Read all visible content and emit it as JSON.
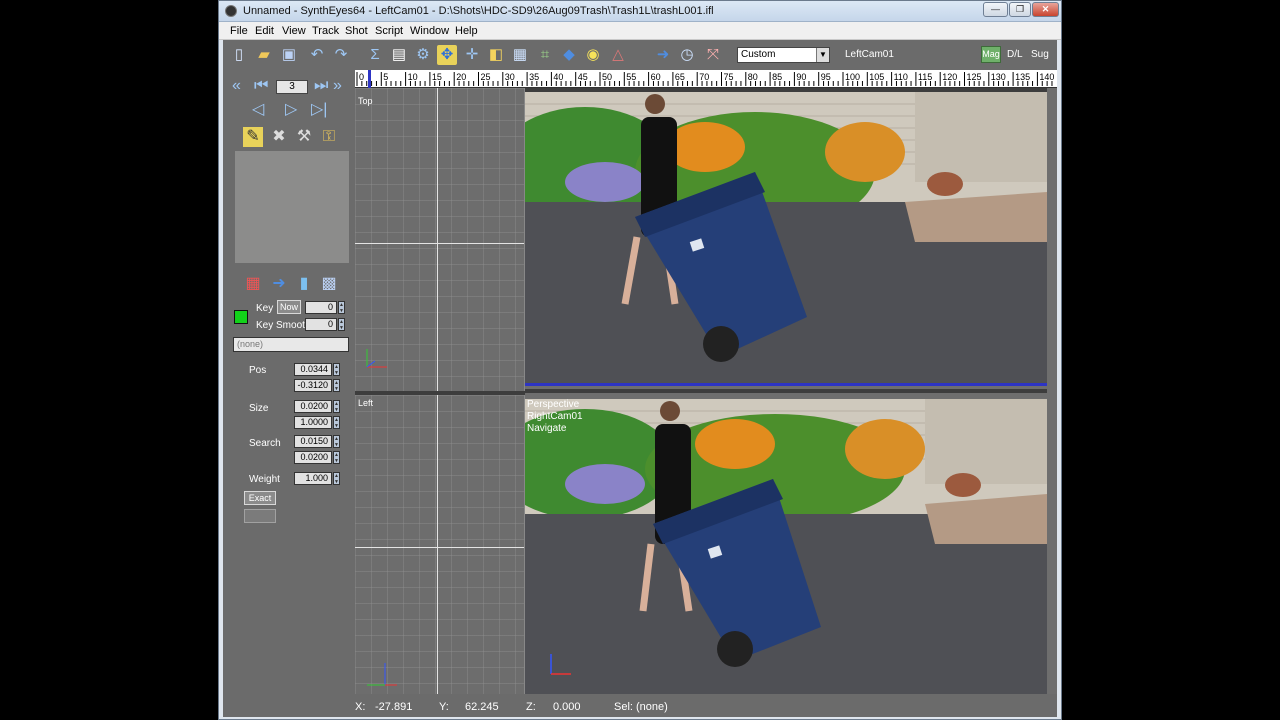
{
  "window": {
    "title": "Unnamed - SynthEyes64 - LeftCam01 - D:\\Shots\\HDC-SD9\\26Aug09Trash\\Trash1L\\trashL001.ifl",
    "minimize": "—",
    "maximize": "❐",
    "close": "✕"
  },
  "menu": [
    "File",
    "Edit",
    "View",
    "Track",
    "Shot",
    "Script",
    "Window",
    "Help"
  ],
  "toolbar": {
    "preset": "Custom",
    "camera_label": "LeftCam01",
    "mag": "Mag",
    "dl": "D/L",
    "sug": "Sug"
  },
  "timeline": {
    "ticks": [
      "0",
      "5",
      "10",
      "15",
      "20",
      "25",
      "30",
      "35",
      "40",
      "45",
      "50",
      "55",
      "60",
      "65",
      "70",
      "75",
      "80",
      "85",
      "90",
      "95",
      "100",
      "105",
      "110",
      "115",
      "120",
      "125",
      "130",
      "135",
      "140"
    ],
    "current_frame": "3"
  },
  "panel": {
    "key_label": "Key",
    "key_now": "Now",
    "key_value": "0",
    "key_smooth_label": "Key Smooth",
    "key_smooth_value": "0",
    "tracker_name": "(none)",
    "pos_label": "Pos",
    "pos_x": "0.0344",
    "pos_y": "-0.3120",
    "size_label": "Size",
    "size_w": "0.0200",
    "size_h": "1.0000",
    "search_label": "Search",
    "search_w": "0.0150",
    "search_h": "0.0200",
    "weight_label": "Weight",
    "weight_value": "1.000",
    "exact_label": "Exact"
  },
  "viewports": {
    "top_label": "Top",
    "left_label": "Left",
    "perspective_lines": [
      "Perspective",
      "RightCam01",
      "Navigate"
    ]
  },
  "status": {
    "x_label": "X:",
    "x_value": "-27.891",
    "y_label": "Y:",
    "y_value": "62.245",
    "z_label": "Z:",
    "z_value": "0.000",
    "sel_label": "Sel:",
    "sel_value": "(none)"
  },
  "colors": {
    "accent_blue": "#2d34c4",
    "tracker_swatch": "#12d21a",
    "panel_bg": "#6b6b6b"
  }
}
